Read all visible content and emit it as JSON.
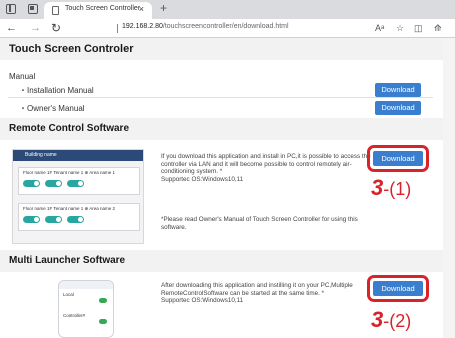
{
  "browser": {
    "tab_title": "Touch Screen Controller",
    "tab_close": "×",
    "new_tab": "+",
    "url_host": "192.168.2.80",
    "url_path": "/touchscreencontroller/en/download.html",
    "read_aloud": "Aᵃ",
    "favorite": "☆",
    "split": "◫",
    "collections": "⟰"
  },
  "page": {
    "title": "Touch Screen Controler",
    "manual": {
      "heading": "Manual",
      "items": [
        {
          "label": "・Installation Manual",
          "button": "Download"
        },
        {
          "label": "・Owner's Manual",
          "button": "Download"
        }
      ]
    },
    "remote": {
      "heading": "Remote Control Software",
      "description": [
        "If you download this application and install in PC,it is possible to access the",
        "controller via LAN and it will become possible to control remotely air-",
        "conditioning system.  *",
        "Supportec OS:Windows10,11"
      ],
      "note": [
        "*Please read Owner's Manual of Touch Screen Controller for using this",
        "software."
      ],
      "button": "Download",
      "callout_num": "3",
      "callout_sub": "-(1)",
      "thumb": {
        "title": "Building name",
        "cards": [
          {
            "label": "Floor name 1F  Tenant name 1   ⊕   Area name 1"
          },
          {
            "label": "Floor name 1F  Tenant name 1   ⊕   Area name 2"
          }
        ]
      }
    },
    "launcher": {
      "heading": "Multi Launcher Software",
      "description": [
        "After downloading this application and instilling it on your PC,Multiple",
        "RemoteControlSoftware can be started at the same time.  *",
        "Supportec OS:Windows10,11"
      ],
      "button": "Download",
      "callout_num": "3",
      "callout_sub": "-(2)",
      "thumb": {
        "rows": [
          "Local",
          "Controller#"
        ]
      }
    }
  }
}
